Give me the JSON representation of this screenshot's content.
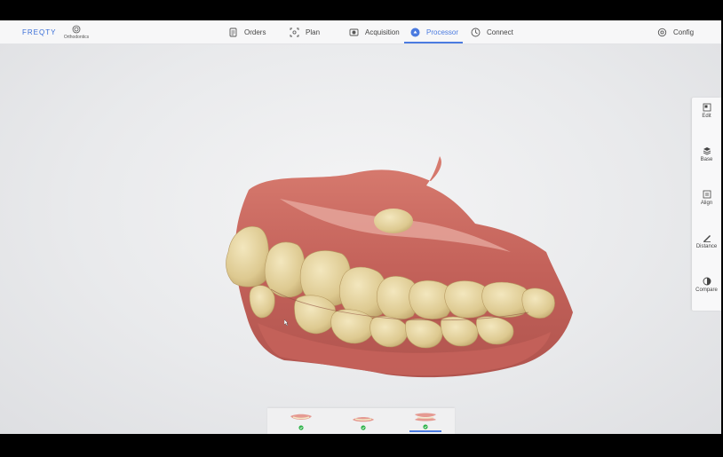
{
  "header": {
    "brand": "FREQTY",
    "module_label": "Orthodontics",
    "nav": [
      {
        "label": "Orders",
        "icon": "orders-icon"
      },
      {
        "label": "Plan",
        "icon": "plan-icon"
      },
      {
        "label": "Acquisition",
        "icon": "acquisition-icon"
      },
      {
        "label": "Processor",
        "icon": "processor-icon",
        "active": true
      },
      {
        "label": "Connect",
        "icon": "connect-icon"
      }
    ],
    "config_label": "Config"
  },
  "tools": [
    {
      "label": "Edit",
      "icon": "edit-icon"
    },
    {
      "label": "Base",
      "icon": "base-icon"
    },
    {
      "label": "Align",
      "icon": "align-icon"
    },
    {
      "label": "Distance",
      "icon": "distance-icon"
    },
    {
      "label": "Compare",
      "icon": "compare-icon"
    }
  ],
  "thumbnails": [
    {
      "name": "upper-jaw",
      "status": "done"
    },
    {
      "name": "lower-jaw",
      "status": "done"
    },
    {
      "name": "bite",
      "status": "done",
      "active": true
    }
  ],
  "colors": {
    "accent": "#4b7be0",
    "brand": "#3a6fd8",
    "check": "#2fb34a",
    "gum": "#c8665d",
    "tooth": "#e6d6a2"
  }
}
